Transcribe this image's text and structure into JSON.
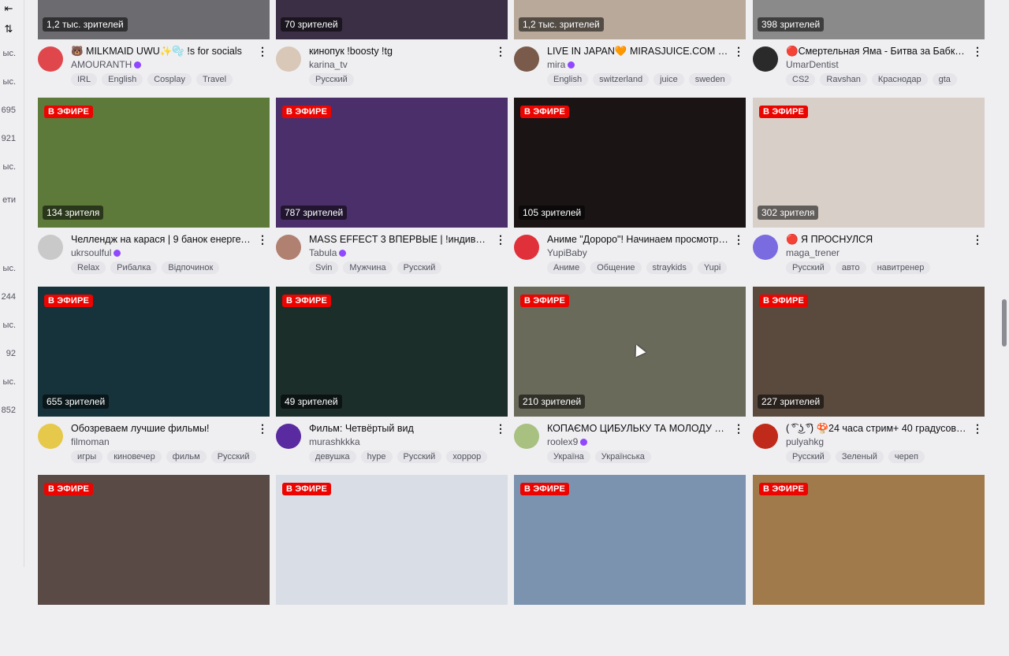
{
  "sidebar": {
    "collapse_icon": "⇤",
    "sort_icon": "⇅",
    "partial_values": [
      "ыс.",
      "ыс.",
      "695",
      "921",
      "ыс.",
      "ети",
      "ыс.",
      "244",
      "ыс.",
      "92",
      "ыс.",
      "852"
    ]
  },
  "live_label": "В ЭФИРЕ",
  "cards": [
    {
      "viewers": "1,2 тыс. зрителей",
      "title": "🐻 MILKMAID UWU✨🫧 !s for socials",
      "channel": "AMOURANTH",
      "verified": true,
      "tags": [
        "IRL",
        "English",
        "Cosplay",
        "Travel"
      ],
      "live": false,
      "thumb_color": "#6b6b70",
      "avatar_color": "#e0474c"
    },
    {
      "viewers": "70 зрителей",
      "title": "кинопук !boosty !tg",
      "channel": "karina_tv",
      "verified": false,
      "tags": [
        "Русский"
      ],
      "live": false,
      "thumb_color": "#3a2f44",
      "avatar_color": "#d9c7b8"
    },
    {
      "viewers": "1,2 тыс. зрителей",
      "title": "LIVE IN JAPAN🧡 MIRASJUICE.COM 🥑 !...",
      "channel": "mira",
      "verified": true,
      "tags": [
        "English",
        "switzerland",
        "juice",
        "sweden"
      ],
      "live": false,
      "thumb_color": "#b8a99a",
      "avatar_color": "#7a5a4a"
    },
    {
      "viewers": "398 зрителей",
      "title": "🔴Смертельная Яма - Битва за Бабки!...",
      "channel": "UmarDentist",
      "verified": false,
      "tags": [
        "CS2",
        "Ravshan",
        "Краснодар",
        "gta"
      ],
      "live": false,
      "thumb_color": "#8a8a8a",
      "avatar_color": "#2a2a2a"
    },
    {
      "viewers": "134 зрителя",
      "title": "Челлендж на карася | 9 банок енергети...",
      "channel": "ukrsoulful",
      "verified": true,
      "tags": [
        "Relax",
        "Рибалка",
        "Відпочинок"
      ],
      "live": true,
      "thumb_color": "#5e7a3a",
      "avatar_color": "#c9c9c9"
    },
    {
      "viewers": "787 зрителей",
      "title": "MASS EFFECT 3 ВПЕРВЫЕ | !индивид !w...",
      "channel": "Tabula",
      "verified": true,
      "tags": [
        "Svin",
        "Мужчина",
        "Русский"
      ],
      "live": true,
      "thumb_color": "#4a2f6a",
      "avatar_color": "#b08070"
    },
    {
      "viewers": "105 зрителей",
      "title": "Аниме \"Дороро\"! Начинаем просмотр н...",
      "channel": "YupiBaby",
      "verified": false,
      "tags": [
        "Аниме",
        "Общение",
        "straykids",
        "Yupi"
      ],
      "live": true,
      "thumb_color": "#1a1414",
      "avatar_color": "#e0303a"
    },
    {
      "viewers": "302 зрителя",
      "title": "🔴 Я ПРОСНУЛСЯ",
      "channel": "maga_trener",
      "verified": false,
      "tags": [
        "Русский",
        "авто",
        "навитренер"
      ],
      "live": true,
      "thumb_color": "#d8cfc8",
      "avatar_color": "#7b6be0"
    },
    {
      "viewers": "655 зрителей",
      "title": "Обозреваем лучшие фильмы!",
      "channel": "filmoman",
      "verified": false,
      "tags": [
        "игры",
        "киновечер",
        "фильм",
        "Русский"
      ],
      "live": true,
      "thumb_color": "#16323a",
      "avatar_color": "#e6c84a"
    },
    {
      "viewers": "49 зрителей",
      "title": "Фильм: Четвёртый вид",
      "channel": "murashkkka",
      "verified": false,
      "tags": [
        "девушка",
        "hype",
        "Русский",
        "хоррор"
      ],
      "live": true,
      "thumb_color": "#1c2e2a",
      "avatar_color": "#5a2aa0"
    },
    {
      "viewers": "210 зрителей",
      "title": "КОПАЄМО ЦИБУЛЬКУ ТА МОЛОДУ КАР...",
      "channel": "roolex9",
      "verified": true,
      "tags": [
        "Україна",
        "Українська"
      ],
      "live": true,
      "thumb_color": "#6a6a5a",
      "avatar_color": "#a8c080"
    },
    {
      "viewers": "227 зрителей",
      "title": "( ͡° ͜ʖ ͡°) 🍄24 часа стрим+ 40 градусов !...",
      "channel": "pulyahkg",
      "verified": false,
      "tags": [
        "Русский",
        "Зеленый",
        "череп"
      ],
      "live": true,
      "thumb_color": "#5a4a3e",
      "avatar_color": "#c02a1a"
    },
    {
      "viewers": "",
      "title": "",
      "channel": "",
      "verified": false,
      "tags": [],
      "live": true,
      "thumb_color": "#5a4a46",
      "avatar_color": "#999"
    },
    {
      "viewers": "",
      "title": "",
      "channel": "",
      "verified": false,
      "tags": [],
      "live": true,
      "thumb_color": "#d9dde6",
      "avatar_color": "#999"
    },
    {
      "viewers": "",
      "title": "",
      "channel": "",
      "verified": false,
      "tags": [],
      "live": true,
      "thumb_color": "#7c93b0",
      "avatar_color": "#999"
    },
    {
      "viewers": "",
      "title": "",
      "channel": "",
      "verified": false,
      "tags": [],
      "live": true,
      "thumb_color": "#a07a4a",
      "avatar_color": "#999"
    }
  ]
}
